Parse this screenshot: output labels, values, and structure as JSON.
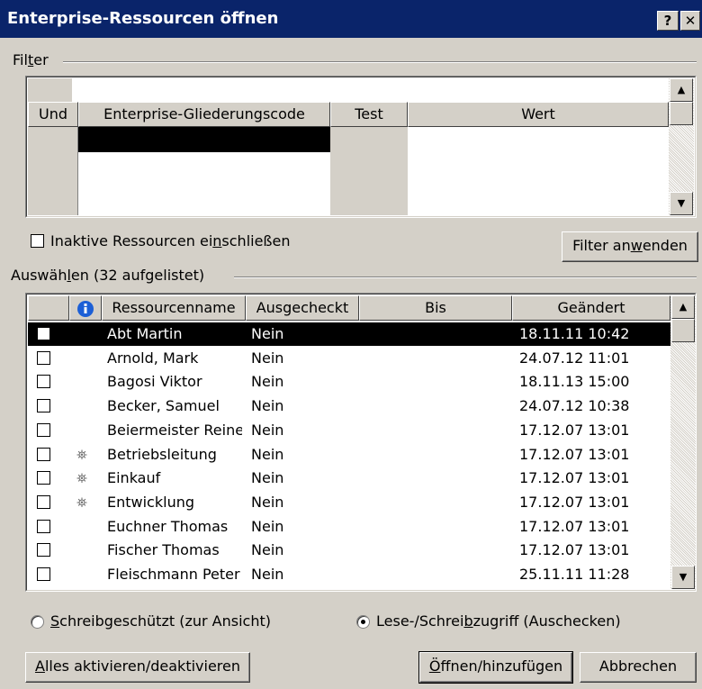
{
  "title": "Enterprise-Ressourcen öffnen",
  "title_buttons": {
    "help": "?",
    "close": "✕"
  },
  "filter": {
    "label_pre": "Fil",
    "label_acc": "t",
    "label_post": "er",
    "columns": [
      "Und",
      "Enterprise-Gliederungscode",
      "Test",
      "Wert"
    ]
  },
  "inactive_checkbox": {
    "pre": "Inaktive Ressourcen ei",
    "acc": "n",
    "post": "schließen"
  },
  "apply_filter_button": {
    "pre": "Filter an",
    "acc": "w",
    "post": "enden"
  },
  "select": {
    "label_pre": "Auswäh",
    "label_acc": "l",
    "label_post": "en (32 aufgelistet)",
    "columns": [
      "Ressourcenname",
      "Ausgecheckt",
      "Bis",
      "Geändert"
    ],
    "rows": [
      {
        "name": "Abt Martin",
        "checked_out": "Nein",
        "until": "",
        "changed": "18.11.11 10:42",
        "icon": "",
        "selected": true
      },
      {
        "name": "Arnold, Mark",
        "checked_out": "Nein",
        "until": "",
        "changed": "24.07.12 11:01",
        "icon": "",
        "selected": false
      },
      {
        "name": "Bagosi Viktor",
        "checked_out": "Nein",
        "until": "",
        "changed": "18.11.13 15:00",
        "icon": "",
        "selected": false
      },
      {
        "name": "Becker, Samuel",
        "checked_out": "Nein",
        "until": "",
        "changed": "24.07.12 10:38",
        "icon": "",
        "selected": false
      },
      {
        "name": "Beiermeister Reine",
        "checked_out": "Nein",
        "until": "",
        "changed": "17.12.07 13:01",
        "icon": "",
        "selected": false
      },
      {
        "name": "Betriebsleitung",
        "checked_out": "Nein",
        "until": "",
        "changed": "17.12.07 13:01",
        "icon": "generic-resource-icon",
        "selected": false
      },
      {
        "name": "Einkauf",
        "checked_out": "Nein",
        "until": "",
        "changed": "17.12.07 13:01",
        "icon": "generic-resource-icon",
        "selected": false
      },
      {
        "name": "Entwicklung",
        "checked_out": "Nein",
        "until": "",
        "changed": "17.12.07 13:01",
        "icon": "generic-resource-icon",
        "selected": false
      },
      {
        "name": "Euchner Thomas",
        "checked_out": "Nein",
        "until": "",
        "changed": "17.12.07 13:01",
        "icon": "",
        "selected": false
      },
      {
        "name": "Fischer Thomas",
        "checked_out": "Nein",
        "until": "",
        "changed": "17.12.07 13:01",
        "icon": "",
        "selected": false
      },
      {
        "name": "Fleischmann Peter",
        "checked_out": "Nein",
        "until": "",
        "changed": "25.11.11 11:28",
        "icon": "",
        "selected": false
      }
    ]
  },
  "mode": {
    "readonly": {
      "acc": "S",
      "post": "chreibgeschützt (zur Ansicht)",
      "checked": false
    },
    "readwrite": {
      "pre": "Lese-/Schrei",
      "acc": "b",
      "post": "zugriff (Auschecken)",
      "checked": true
    }
  },
  "buttons": {
    "toggle_all": {
      "acc": "A",
      "post": "lles aktivieren/deaktivieren"
    },
    "open": {
      "acc": "Ö",
      "post": "ffnen/hinzufügen"
    },
    "cancel": "Abbrechen"
  },
  "colors": {
    "titlebar": "#0a246a",
    "dialog": "#d4d0c8",
    "selection": "#000000",
    "info_icon": "#1c5fd6"
  }
}
